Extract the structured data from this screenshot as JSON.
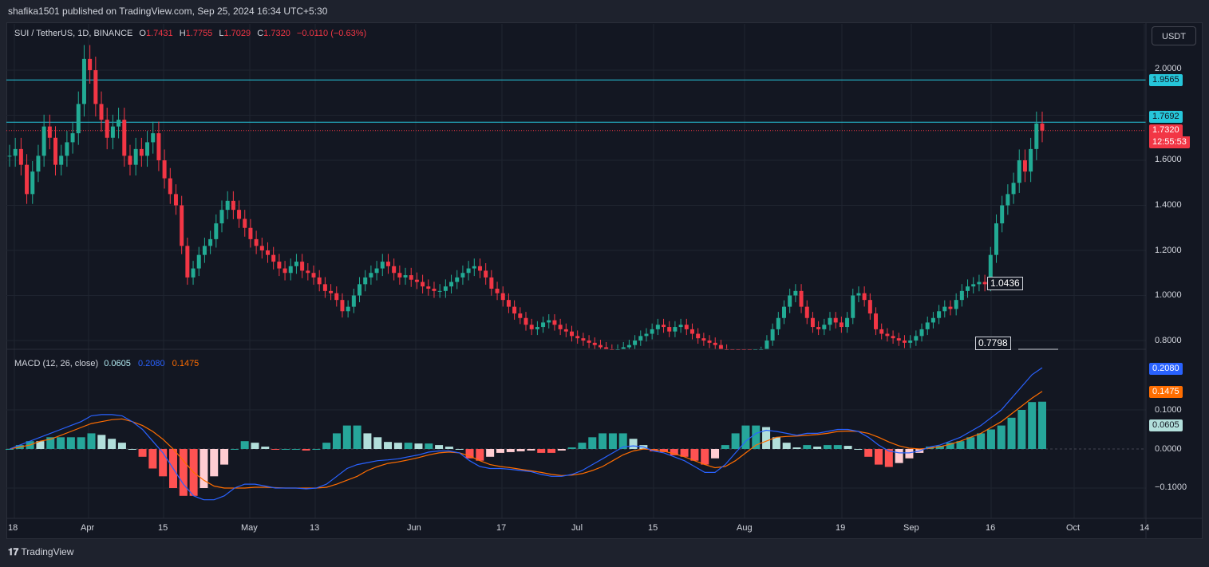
{
  "header": {
    "published_line": "shafika1501 published on TradingView.com, Sep 25, 2024 16:34 UTC+5:30"
  },
  "symbol": {
    "name": "SUI / TetherUS, 1D, BINANCE",
    "open_label": "O",
    "open": "1.7431",
    "high_label": "H",
    "high": "1.7755",
    "low_label": "L",
    "low": "1.7029",
    "close_label": "C",
    "close": "1.7320",
    "change": "−0.0110 (−0.63%)"
  },
  "currency_button": "USDT",
  "price_scale": {
    "ticks": [
      "2.0000",
      "1.6000",
      "1.4000",
      "1.2000",
      "1.0000",
      "0.8000"
    ],
    "level_high": "1.9565",
    "level_mid": "1.7692",
    "last_price": "1.7320",
    "countdown": "12:55:53"
  },
  "annotations": {
    "label_a": "1.0436",
    "label_b": "0.7798"
  },
  "macd": {
    "title": "MACD (12, 26, close)",
    "hist": "0.0605",
    "macd": "0.2080",
    "signal": "0.1475",
    "ticks": [
      "0.1000",
      "0.0000",
      "−0.1000"
    ]
  },
  "time_axis": [
    "18",
    "Apr",
    "15",
    "May",
    "13",
    "Jun",
    "17",
    "Jul",
    "15",
    "Aug",
    "19",
    "Sep",
    "16",
    "Oct",
    "14"
  ],
  "footer": {
    "logo_mark": "𝟏𝟕",
    "brand": "TradingView"
  },
  "colors": {
    "up": "#22ab94",
    "down": "#f23645",
    "level_line": "#26c6da",
    "macd_line": "#2962ff",
    "signal_line": "#ff6d00",
    "hist_up_strong": "#26a69a",
    "hist_up_weak": "#b2dfdb",
    "hist_down_strong": "#ff5252",
    "hist_down_weak": "#ffcdd2"
  },
  "chart_data": [
    {
      "type": "candlestick",
      "title": "SUI / TetherUS, 1D, BINANCE",
      "ylim": [
        0.77,
        2.2
      ],
      "x_range": [
        "2024-03-18",
        "2024-10-20"
      ],
      "horizontal_levels": [
        1.9565,
        1.7692
      ],
      "approximate_closes": [
        1.62,
        1.65,
        1.58,
        1.45,
        1.55,
        1.62,
        1.75,
        1.7,
        1.58,
        1.62,
        1.68,
        1.72,
        1.85,
        2.05,
        2.0,
        1.85,
        1.78,
        1.7,
        1.75,
        1.78,
        1.62,
        1.58,
        1.65,
        1.62,
        1.68,
        1.72,
        1.6,
        1.52,
        1.45,
        1.4,
        1.22,
        1.08,
        1.12,
        1.18,
        1.22,
        1.25,
        1.32,
        1.38,
        1.42,
        1.38,
        1.34,
        1.3,
        1.25,
        1.22,
        1.2,
        1.18,
        1.15,
        1.12,
        1.1,
        1.13,
        1.15,
        1.11,
        1.1,
        1.08,
        1.05,
        1.02,
        1.01,
        0.98,
        0.93,
        0.95,
        1.0,
        1.05,
        1.08,
        1.1,
        1.12,
        1.15,
        1.13,
        1.1,
        1.08,
        1.09,
        1.07,
        1.06,
        1.04,
        1.03,
        1.02,
        1.02,
        1.04,
        1.06,
        1.08,
        1.1,
        1.12,
        1.13,
        1.11,
        1.08,
        1.03,
        1.01,
        0.98,
        0.95,
        0.92,
        0.9,
        0.87,
        0.85,
        0.86,
        0.88,
        0.89,
        0.87,
        0.85,
        0.84,
        0.82,
        0.81,
        0.8,
        0.79,
        0.78,
        0.77,
        0.76,
        0.75,
        0.76,
        0.77,
        0.78,
        0.8,
        0.82,
        0.83,
        0.85,
        0.87,
        0.86,
        0.84,
        0.86,
        0.87,
        0.85,
        0.83,
        0.81,
        0.8,
        0.79,
        0.78,
        0.76,
        0.74,
        0.73,
        0.72,
        0.71,
        0.7,
        0.71,
        0.75,
        0.8,
        0.85,
        0.9,
        0.95,
        1.0,
        1.02,
        0.95,
        0.9,
        0.86,
        0.85,
        0.87,
        0.9,
        0.88,
        0.86,
        0.9,
        1.0,
        1.01,
        0.98,
        0.92,
        0.85,
        0.83,
        0.82,
        0.81,
        0.8,
        0.79,
        0.8,
        0.82,
        0.85,
        0.88,
        0.9,
        0.93,
        0.95,
        0.94,
        0.98,
        1.02,
        1.04,
        1.05,
        1.06,
        1.05,
        1.18,
        1.32,
        1.4,
        1.45,
        1.5,
        1.6,
        1.55,
        1.65,
        1.7632,
        1.732
      ]
    },
    {
      "type": "line",
      "title": "MACD (12, 26, close)",
      "ylim": [
        -0.14,
        0.22
      ],
      "x_range": [
        "2024-03-18",
        "2024-10-20"
      ],
      "series": [
        {
          "name": "MACD",
          "key": "macd",
          "values": [
            0.0,
            0.01,
            0.02,
            0.03,
            0.04,
            0.05,
            0.06,
            0.07,
            0.085,
            0.088,
            0.088,
            0.085,
            0.07,
            0.05,
            0.02,
            -0.01,
            -0.05,
            -0.09,
            -0.12,
            -0.13,
            -0.13,
            -0.12,
            -0.1,
            -0.09,
            -0.09,
            -0.095,
            -0.1,
            -0.1,
            -0.1,
            -0.102,
            -0.1,
            -0.09,
            -0.07,
            -0.05,
            -0.04,
            -0.035,
            -0.03,
            -0.028,
            -0.025,
            -0.02,
            -0.015,
            -0.008,
            -0.005,
            -0.005,
            -0.01,
            -0.03,
            -0.045,
            -0.05,
            -0.05,
            -0.052,
            -0.055,
            -0.058,
            -0.065,
            -0.07,
            -0.07,
            -0.065,
            -0.055,
            -0.04,
            -0.025,
            -0.01,
            0.005,
            0.008,
            0.005,
            -0.005,
            -0.01,
            -0.02,
            -0.03,
            -0.045,
            -0.06,
            -0.06,
            -0.04,
            -0.01,
            0.02,
            0.04,
            0.048,
            0.045,
            0.04,
            0.035,
            0.04,
            0.04,
            0.045,
            0.05,
            0.05,
            0.045,
            0.03,
            0.01,
            -0.005,
            -0.01,
            -0.01,
            -0.005,
            0.005,
            0.01,
            0.02,
            0.03,
            0.045,
            0.06,
            0.08,
            0.1,
            0.13,
            0.16,
            0.19,
            0.208
          ]
        },
        {
          "name": "Signal",
          "key": "signal",
          "values": [
            0.0,
            0.005,
            0.01,
            0.02,
            0.025,
            0.035,
            0.045,
            0.055,
            0.065,
            0.07,
            0.075,
            0.077,
            0.07,
            0.06,
            0.045,
            0.025,
            0.0,
            -0.03,
            -0.06,
            -0.08,
            -0.095,
            -0.1,
            -0.1,
            -0.1,
            -0.098,
            -0.098,
            -0.099,
            -0.1,
            -0.1,
            -0.1,
            -0.1,
            -0.098,
            -0.09,
            -0.08,
            -0.07,
            -0.055,
            -0.045,
            -0.037,
            -0.033,
            -0.028,
            -0.022,
            -0.015,
            -0.01,
            -0.008,
            -0.01,
            -0.018,
            -0.03,
            -0.04,
            -0.045,
            -0.048,
            -0.052,
            -0.056,
            -0.06,
            -0.065,
            -0.068,
            -0.067,
            -0.063,
            -0.055,
            -0.045,
            -0.03,
            -0.015,
            -0.005,
            0.0,
            -0.002,
            -0.006,
            -0.012,
            -0.02,
            -0.03,
            -0.04,
            -0.048,
            -0.045,
            -0.03,
            -0.01,
            0.01,
            0.02,
            0.03,
            0.032,
            0.033,
            0.035,
            0.037,
            0.04,
            0.045,
            0.046,
            0.045,
            0.04,
            0.03,
            0.018,
            0.008,
            0.002,
            0.0,
            0.002,
            0.006,
            0.012,
            0.02,
            0.03,
            0.04,
            0.055,
            0.07,
            0.09,
            0.11,
            0.13,
            0.1475
          ]
        }
      ]
    }
  ]
}
